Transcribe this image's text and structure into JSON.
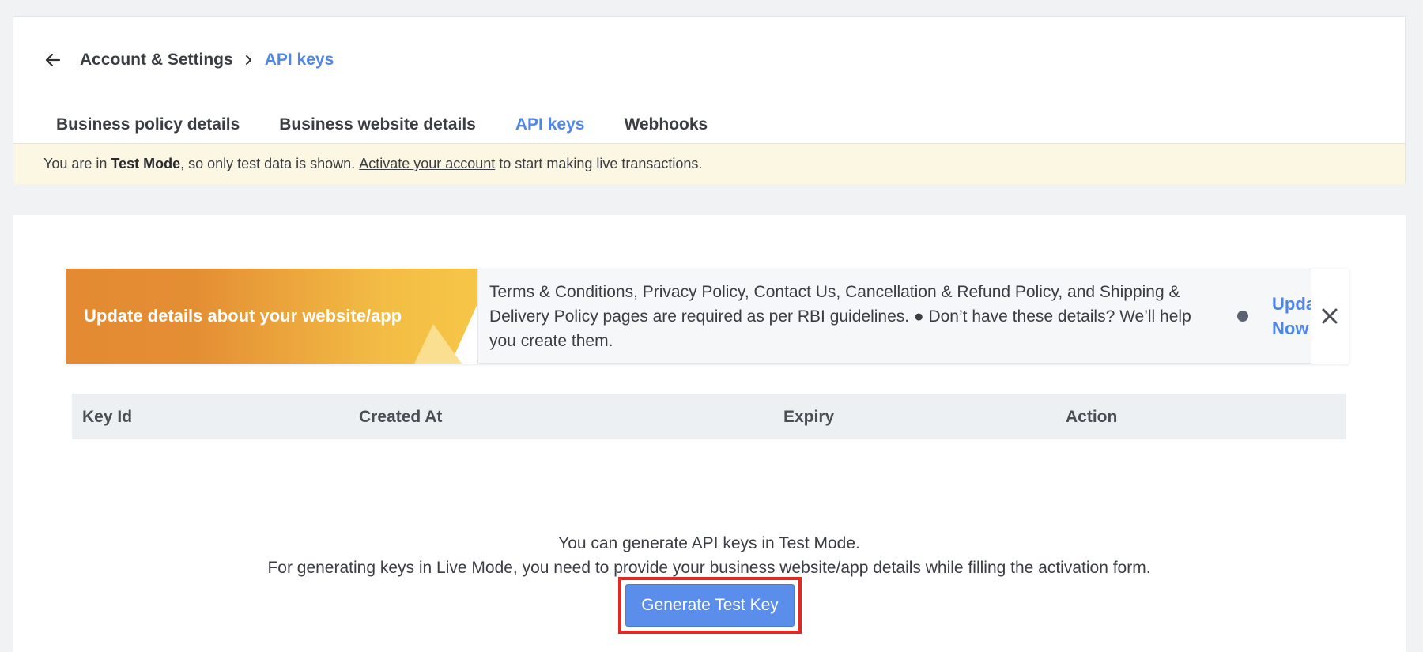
{
  "breadcrumb": {
    "parent": "Account & Settings",
    "current": "API keys"
  },
  "tabs": [
    {
      "label": "Business policy details",
      "active": false
    },
    {
      "label": "Business website details",
      "active": false
    },
    {
      "label": "API keys",
      "active": true
    },
    {
      "label": "Webhooks",
      "active": false
    }
  ],
  "test_banner": {
    "prefix": "You are in ",
    "mode": "Test Mode",
    "middle": ", so only test data is shown. ",
    "link": "Activate your account",
    "suffix": " to start making live transactions."
  },
  "notice": {
    "title": "Update details about your website/app",
    "text": "Terms & Conditions, Privacy Policy, Contact Us, Cancellation & Refund Policy, and Shipping & Delivery Policy pages are required as per RBI guidelines. ● Don’t have these details? We’ll help you create them.",
    "action": "Update Now"
  },
  "table": {
    "columns": [
      "Key Id",
      "Created At",
      "Expiry",
      "Action"
    ]
  },
  "empty_state": {
    "line1": "You can generate API keys in Test Mode.",
    "line2": "For generating keys in Live Mode, you need to provide your business website/app details while filling the activation form.",
    "button": "Generate Test Key"
  },
  "colors": {
    "accent": "#4f86e8",
    "button": "#5b8eea",
    "highlight": "#e02b24",
    "banner": "#fcf7e3"
  }
}
